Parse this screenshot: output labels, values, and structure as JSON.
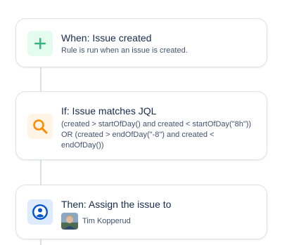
{
  "flow": {
    "trigger": {
      "title": "When: Issue created",
      "description": "Rule is run when an issue is created.",
      "icon": "plus-icon",
      "accent_color": "#36b37e",
      "icon_bg": "#e3fcef"
    },
    "condition": {
      "title": "If: Issue matches JQL",
      "description_lines": [
        "(created > startOfDay() and created < startOfDay(\"8h\"))",
        "OR (created > endOfDay(\"-8\") and created <",
        "endOfDay())"
      ],
      "icon": "search-icon",
      "accent_color": "#ff8b00",
      "icon_bg": "#fff4e5"
    },
    "action": {
      "title": "Then: Assign the issue to",
      "assignee": "Tim Kopperud",
      "icon": "user-circle-icon",
      "accent_color": "#0052cc",
      "icon_bg": "#deebff"
    }
  }
}
